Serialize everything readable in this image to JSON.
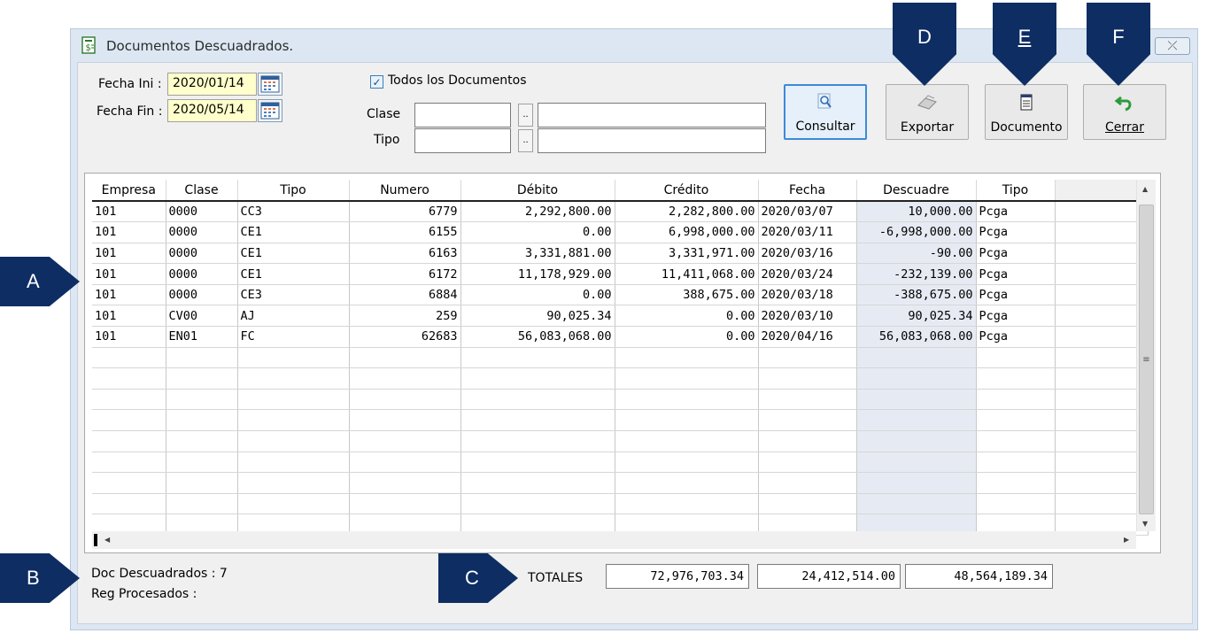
{
  "window": {
    "title": "Documentos Descuadrados.",
    "close_label": "⤫"
  },
  "filters": {
    "fecha_ini_label": "Fecha Ini :",
    "fecha_ini_value": "2020/01/14",
    "fecha_fin_label": "Fecha Fin :",
    "fecha_fin_value": "2020/05/14",
    "todos_checked_glyph": "✓",
    "todos_label": "Todos los Documentos",
    "clase_label": "Clase",
    "tipo_label": "Tipo",
    "ellipsis": ".."
  },
  "toolbar": {
    "consultar": "Consultar",
    "exportar": "Exportar",
    "documento": "Documento",
    "cerrar": "Cerrar"
  },
  "grid": {
    "columns": [
      "Empresa",
      "Clase",
      "Tipo",
      "Numero",
      "Débito",
      "Crédito",
      "Fecha",
      "Descuadre",
      "Tipo"
    ],
    "rows": [
      [
        "101",
        "0000",
        "CC3",
        "6779",
        "2,292,800.00",
        "2,282,800.00",
        "2020/03/07",
        "10,000.00",
        "Pcga"
      ],
      [
        "101",
        "0000",
        "CE1",
        "6155",
        "0.00",
        "6,998,000.00",
        "2020/03/11",
        "-6,998,000.00",
        "Pcga"
      ],
      [
        "101",
        "0000",
        "CE1",
        "6163",
        "3,331,881.00",
        "3,331,971.00",
        "2020/03/16",
        "-90.00",
        "Pcga"
      ],
      [
        "101",
        "0000",
        "CE1",
        "6172",
        "11,178,929.00",
        "11,411,068.00",
        "2020/03/24",
        "-232,139.00",
        "Pcga"
      ],
      [
        "101",
        "0000",
        "CE3",
        "6884",
        "0.00",
        "388,675.00",
        "2020/03/18",
        "-388,675.00",
        "Pcga"
      ],
      [
        "101",
        "CV00",
        "AJ",
        "259",
        "90,025.34",
        "0.00",
        "2020/03/10",
        "90,025.34",
        "Pcga"
      ],
      [
        "101",
        "EN01",
        "FC",
        "62683",
        "56,083,068.00",
        "0.00",
        "2020/04/16",
        "56,083,068.00",
        "Pcga"
      ]
    ],
    "empty_row_count": 9
  },
  "footer": {
    "doc_descuadrados_label": "Doc Descuadrados : 7",
    "reg_procesados_label": "Reg Procesados :",
    "totales_label": "TOTALES",
    "total_debito": "72,976,703.34",
    "total_credito": "24,412,514.00",
    "total_descuadre": "48,564,189.34"
  },
  "callouts": {
    "a": "A",
    "b": "B",
    "c": "C",
    "d": "D",
    "e": "E",
    "f": "F"
  },
  "colors": {
    "callout": "#0d2d63",
    "date_field": "#ffffcc",
    "window_frame": "#dce7f3",
    "descuadre_column": "#e6ebf3"
  }
}
